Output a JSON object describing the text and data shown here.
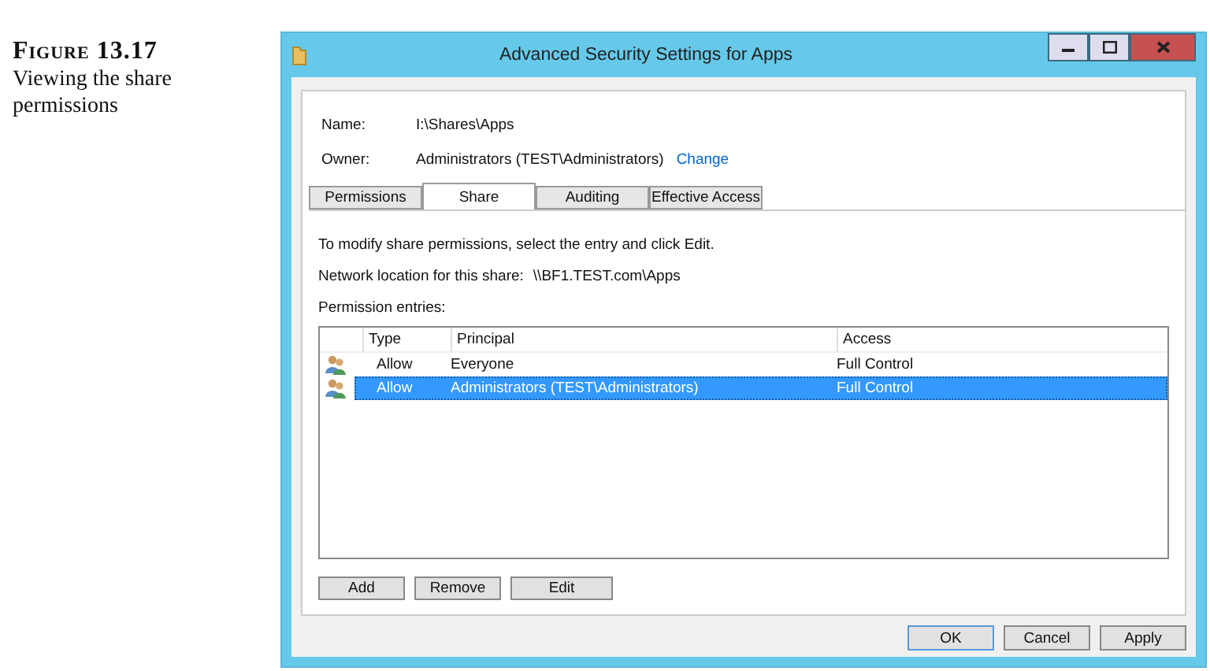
{
  "figure": {
    "label": "Figure 13.17",
    "caption": "Viewing the share permissions"
  },
  "window": {
    "title": "Advanced Security Settings for Apps"
  },
  "name": {
    "label": "Name:",
    "value": "I:\\Shares\\Apps"
  },
  "owner": {
    "label": "Owner:",
    "value": "Administrators (TEST\\Administrators)",
    "link": "Change"
  },
  "tabs": [
    {
      "label": "Permissions",
      "selected": false
    },
    {
      "label": "Share",
      "selected": true
    },
    {
      "label": "Auditing",
      "selected": false
    },
    {
      "label": "Effective Access",
      "selected": false
    }
  ],
  "instruction": "To modify share permissions, select the entry and click Edit.",
  "network": {
    "label": "Network location for this share:",
    "value": "\\\\BF1.TEST.com\\Apps"
  },
  "entries_label": "Permission entries:",
  "table": {
    "columns": [
      "Type",
      "Principal",
      "Access"
    ],
    "rows": [
      {
        "cells": [
          "Allow",
          "Everyone",
          "Full Control"
        ],
        "selected": false
      },
      {
        "cells": [
          "Allow",
          "Administrators (TEST\\Administrators)",
          "Full Control"
        ],
        "selected": true
      }
    ]
  },
  "list_buttons": [
    "Add",
    "Remove",
    "Edit"
  ],
  "dialog_buttons": [
    "OK",
    "Cancel",
    "Apply"
  ]
}
